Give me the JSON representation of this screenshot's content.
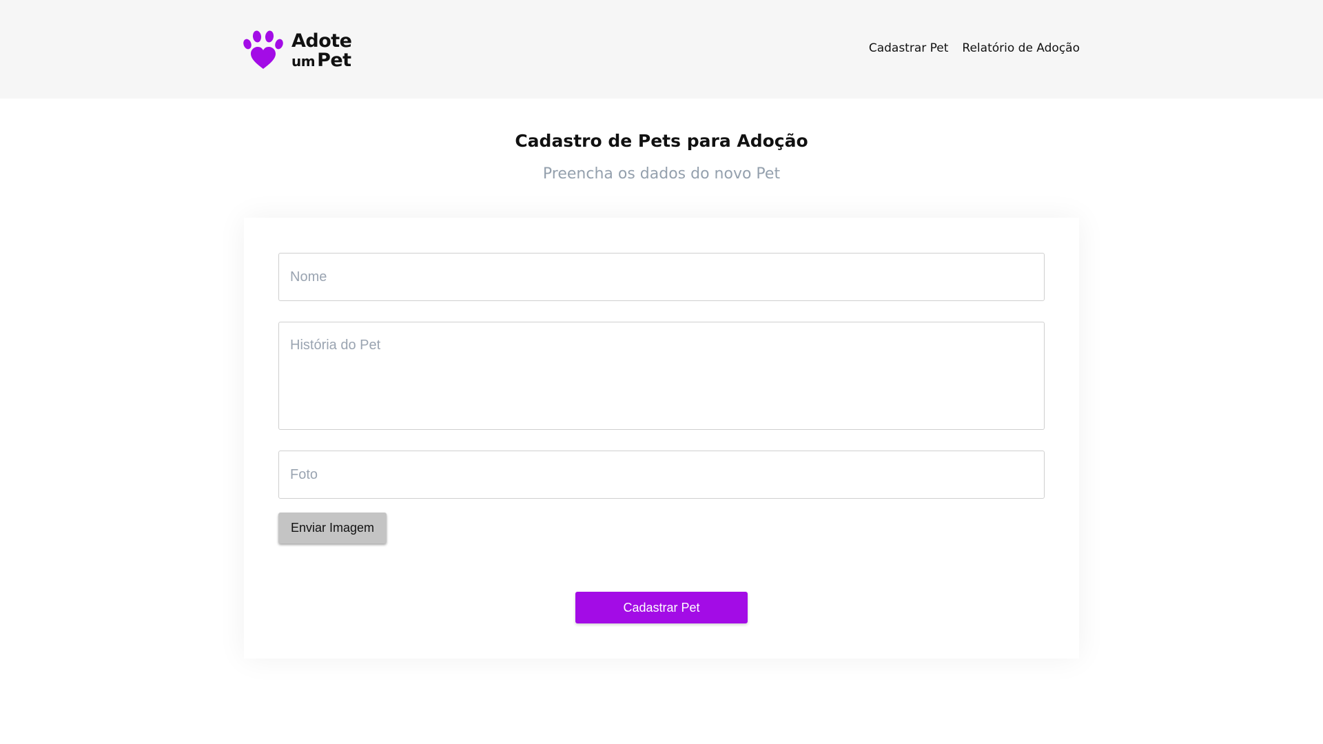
{
  "brand": {
    "line1": "Adote",
    "line2_small": "um",
    "line2_large": "Pet",
    "accent_color": "#a30ce6",
    "icon": "paw-heart-icon"
  },
  "nav": {
    "items": [
      {
        "label": "Cadastrar Pet"
      },
      {
        "label": "Relatório de Adoção"
      }
    ]
  },
  "page": {
    "title": "Cadastro de Pets para Adoção",
    "subtitle": "Preencha os dados do novo Pet"
  },
  "form": {
    "nome": {
      "placeholder": "Nome",
      "value": ""
    },
    "historia": {
      "placeholder": "História do Pet",
      "value": ""
    },
    "foto": {
      "placeholder": "Foto",
      "value": ""
    },
    "upload_label": "Enviar Imagem",
    "submit_label": "Cadastrar Pet",
    "submit_color": "#a30ce6"
  }
}
